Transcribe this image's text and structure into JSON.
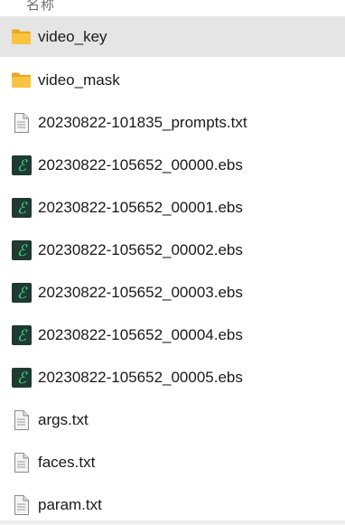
{
  "header": {
    "name_column": "名称"
  },
  "files": [
    {
      "name": "video_key",
      "type": "folder",
      "selected": true
    },
    {
      "name": "video_mask",
      "type": "folder",
      "selected": false
    },
    {
      "name": "20230822-101835_prompts.txt",
      "type": "text",
      "selected": false
    },
    {
      "name": "20230822-105652_00000.ebs",
      "type": "ebs",
      "selected": false
    },
    {
      "name": "20230822-105652_00001.ebs",
      "type": "ebs",
      "selected": false
    },
    {
      "name": "20230822-105652_00002.ebs",
      "type": "ebs",
      "selected": false
    },
    {
      "name": "20230822-105652_00003.ebs",
      "type": "ebs",
      "selected": false
    },
    {
      "name": "20230822-105652_00004.ebs",
      "type": "ebs",
      "selected": false
    },
    {
      "name": "20230822-105652_00005.ebs",
      "type": "ebs",
      "selected": false
    },
    {
      "name": "args.txt",
      "type": "text",
      "selected": false
    },
    {
      "name": "faces.txt",
      "type": "text",
      "selected": false
    },
    {
      "name": "param.txt",
      "type": "text",
      "selected": false
    }
  ],
  "colors": {
    "selection": "#e5e5e5",
    "folder": "#f8c43f",
    "ebs_bg": "#1f3a33",
    "ebs_glyph": "#3ee08a"
  }
}
